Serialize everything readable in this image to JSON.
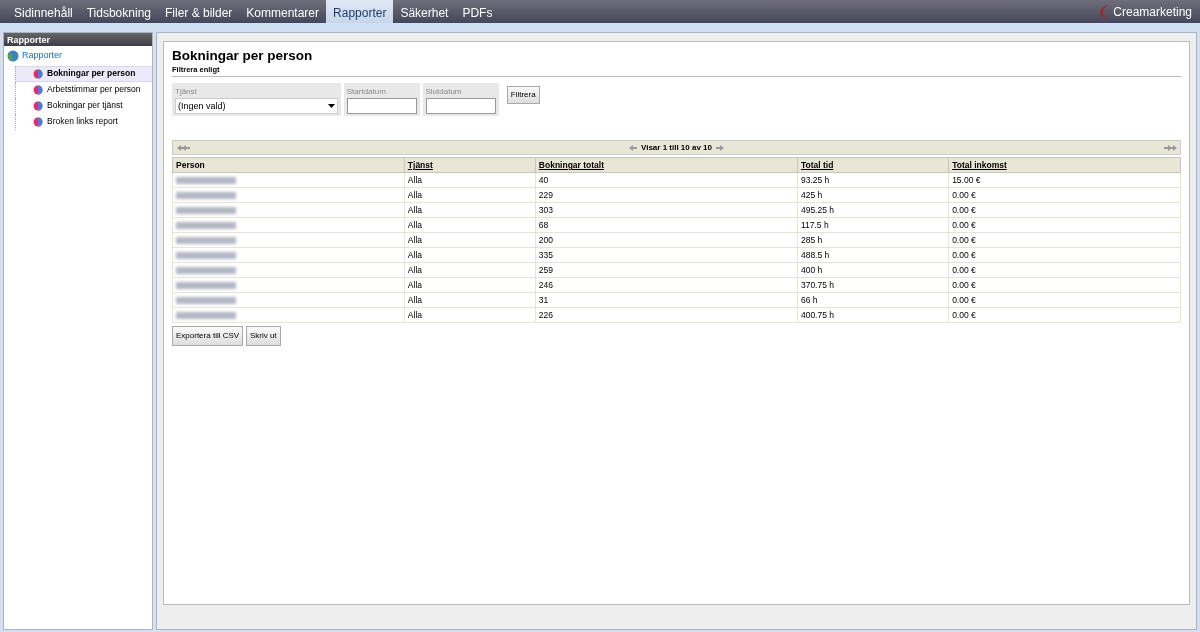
{
  "topnav": {
    "tabs": [
      {
        "label": "Sidinnehåll",
        "selected": false
      },
      {
        "label": "Tidsbokning",
        "selected": false
      },
      {
        "label": "Filer & bilder",
        "selected": false
      },
      {
        "label": "Kommentarer",
        "selected": false
      },
      {
        "label": "Rapporter",
        "selected": true
      },
      {
        "label": "Säkerhet",
        "selected": false
      },
      {
        "label": "PDFs",
        "selected": false
      }
    ],
    "brand": "Creamarketing"
  },
  "sidebar": {
    "title": "Rapporter",
    "root": {
      "label": "Rapporter",
      "children": [
        {
          "label": "Bokningar per person",
          "selected": true
        },
        {
          "label": "Arbetstimmar per person",
          "selected": false
        },
        {
          "label": "Bokningar per tjänst",
          "selected": false
        },
        {
          "label": "Broken links report",
          "selected": false
        }
      ]
    }
  },
  "main": {
    "title": "Bokningar per person",
    "subtitle": "Filtrera enligt",
    "filters": {
      "service": {
        "label": "Tjänst",
        "value": "(Ingen vald)"
      },
      "start": {
        "label": "Startdatum"
      },
      "end": {
        "label": "Slutdatum"
      },
      "button": "Filtrera"
    },
    "pager": "Visar 1 till 10 av 10",
    "table": {
      "columns": [
        {
          "label": "Person",
          "sortable": false
        },
        {
          "label": "Tjänst",
          "sortable": true
        },
        {
          "label": "Bokningar totalt",
          "sortable": true
        },
        {
          "label": "Total tid",
          "sortable": true
        },
        {
          "label": "Total inkomst",
          "sortable": true
        }
      ],
      "rows": [
        {
          "person_blurred": true,
          "service": "Alla",
          "bookings": "40",
          "time": "93.25 h",
          "income": "15.00 €"
        },
        {
          "person_blurred": true,
          "service": "Alla",
          "bookings": "229",
          "time": "425 h",
          "income": "0.00 €"
        },
        {
          "person_blurred": true,
          "service": "Alla",
          "bookings": "303",
          "time": "495.25 h",
          "income": "0.00 €"
        },
        {
          "person_blurred": true,
          "service": "Alla",
          "bookings": "68",
          "time": "117.5 h",
          "income": "0.00 €"
        },
        {
          "person_blurred": true,
          "service": "Alla",
          "bookings": "200",
          "time": "285 h",
          "income": "0.00 €"
        },
        {
          "person_blurred": true,
          "service": "Alla",
          "bookings": "335",
          "time": "488.5 h",
          "income": "0.00 €"
        },
        {
          "person_blurred": true,
          "service": "Alla",
          "bookings": "259",
          "time": "400 h",
          "income": "0.00 €"
        },
        {
          "person_blurred": true,
          "service": "Alla",
          "bookings": "246",
          "time": "370.75 h",
          "income": "0.00 €"
        },
        {
          "person_blurred": true,
          "service": "Alla",
          "bookings": "31",
          "time": "66 h",
          "income": "0.00 €"
        },
        {
          "person_blurred": true,
          "service": "Alla",
          "bookings": "226",
          "time": "400.75 h",
          "income": "0.00 €"
        }
      ]
    },
    "actions": [
      "Exportera till CSV",
      "Skriv ut"
    ]
  }
}
